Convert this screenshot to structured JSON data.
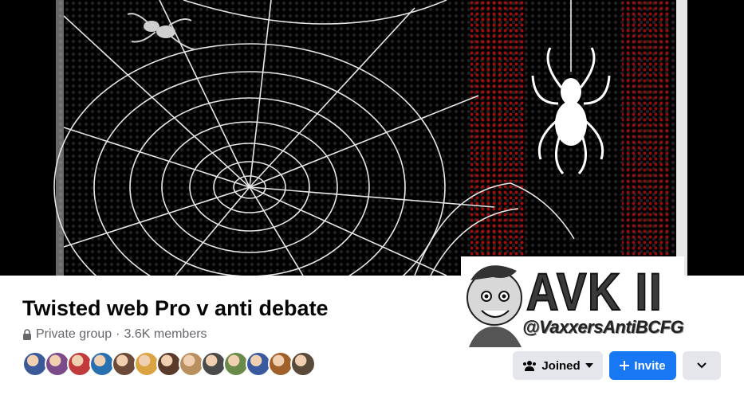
{
  "group": {
    "name": "Twisted web Pro v anti debate",
    "privacy": "Private group",
    "separator": "·",
    "members": "3.6K members",
    "member_avatars": [
      "#3b5998",
      "#7a4a8a",
      "#c23b3b",
      "#2a6fb0",
      "#6b4a3a",
      "#d9a441",
      "#5a3a2a",
      "#b89060",
      "#4a4a4a",
      "#6a8a4a",
      "#3a5aa0",
      "#a0602a",
      "#5a4a3a"
    ]
  },
  "badge": {
    "title": "AVK II",
    "handle": "@VaxxersAntiBCFG"
  },
  "actions": {
    "joined_label": "Joined",
    "invite_label": "Invite",
    "more_icon": "chevron-down-icon"
  },
  "colors": {
    "accent": "#1877f2",
    "secondary_button": "#e4e6eb",
    "muted_text": "#65676b"
  }
}
